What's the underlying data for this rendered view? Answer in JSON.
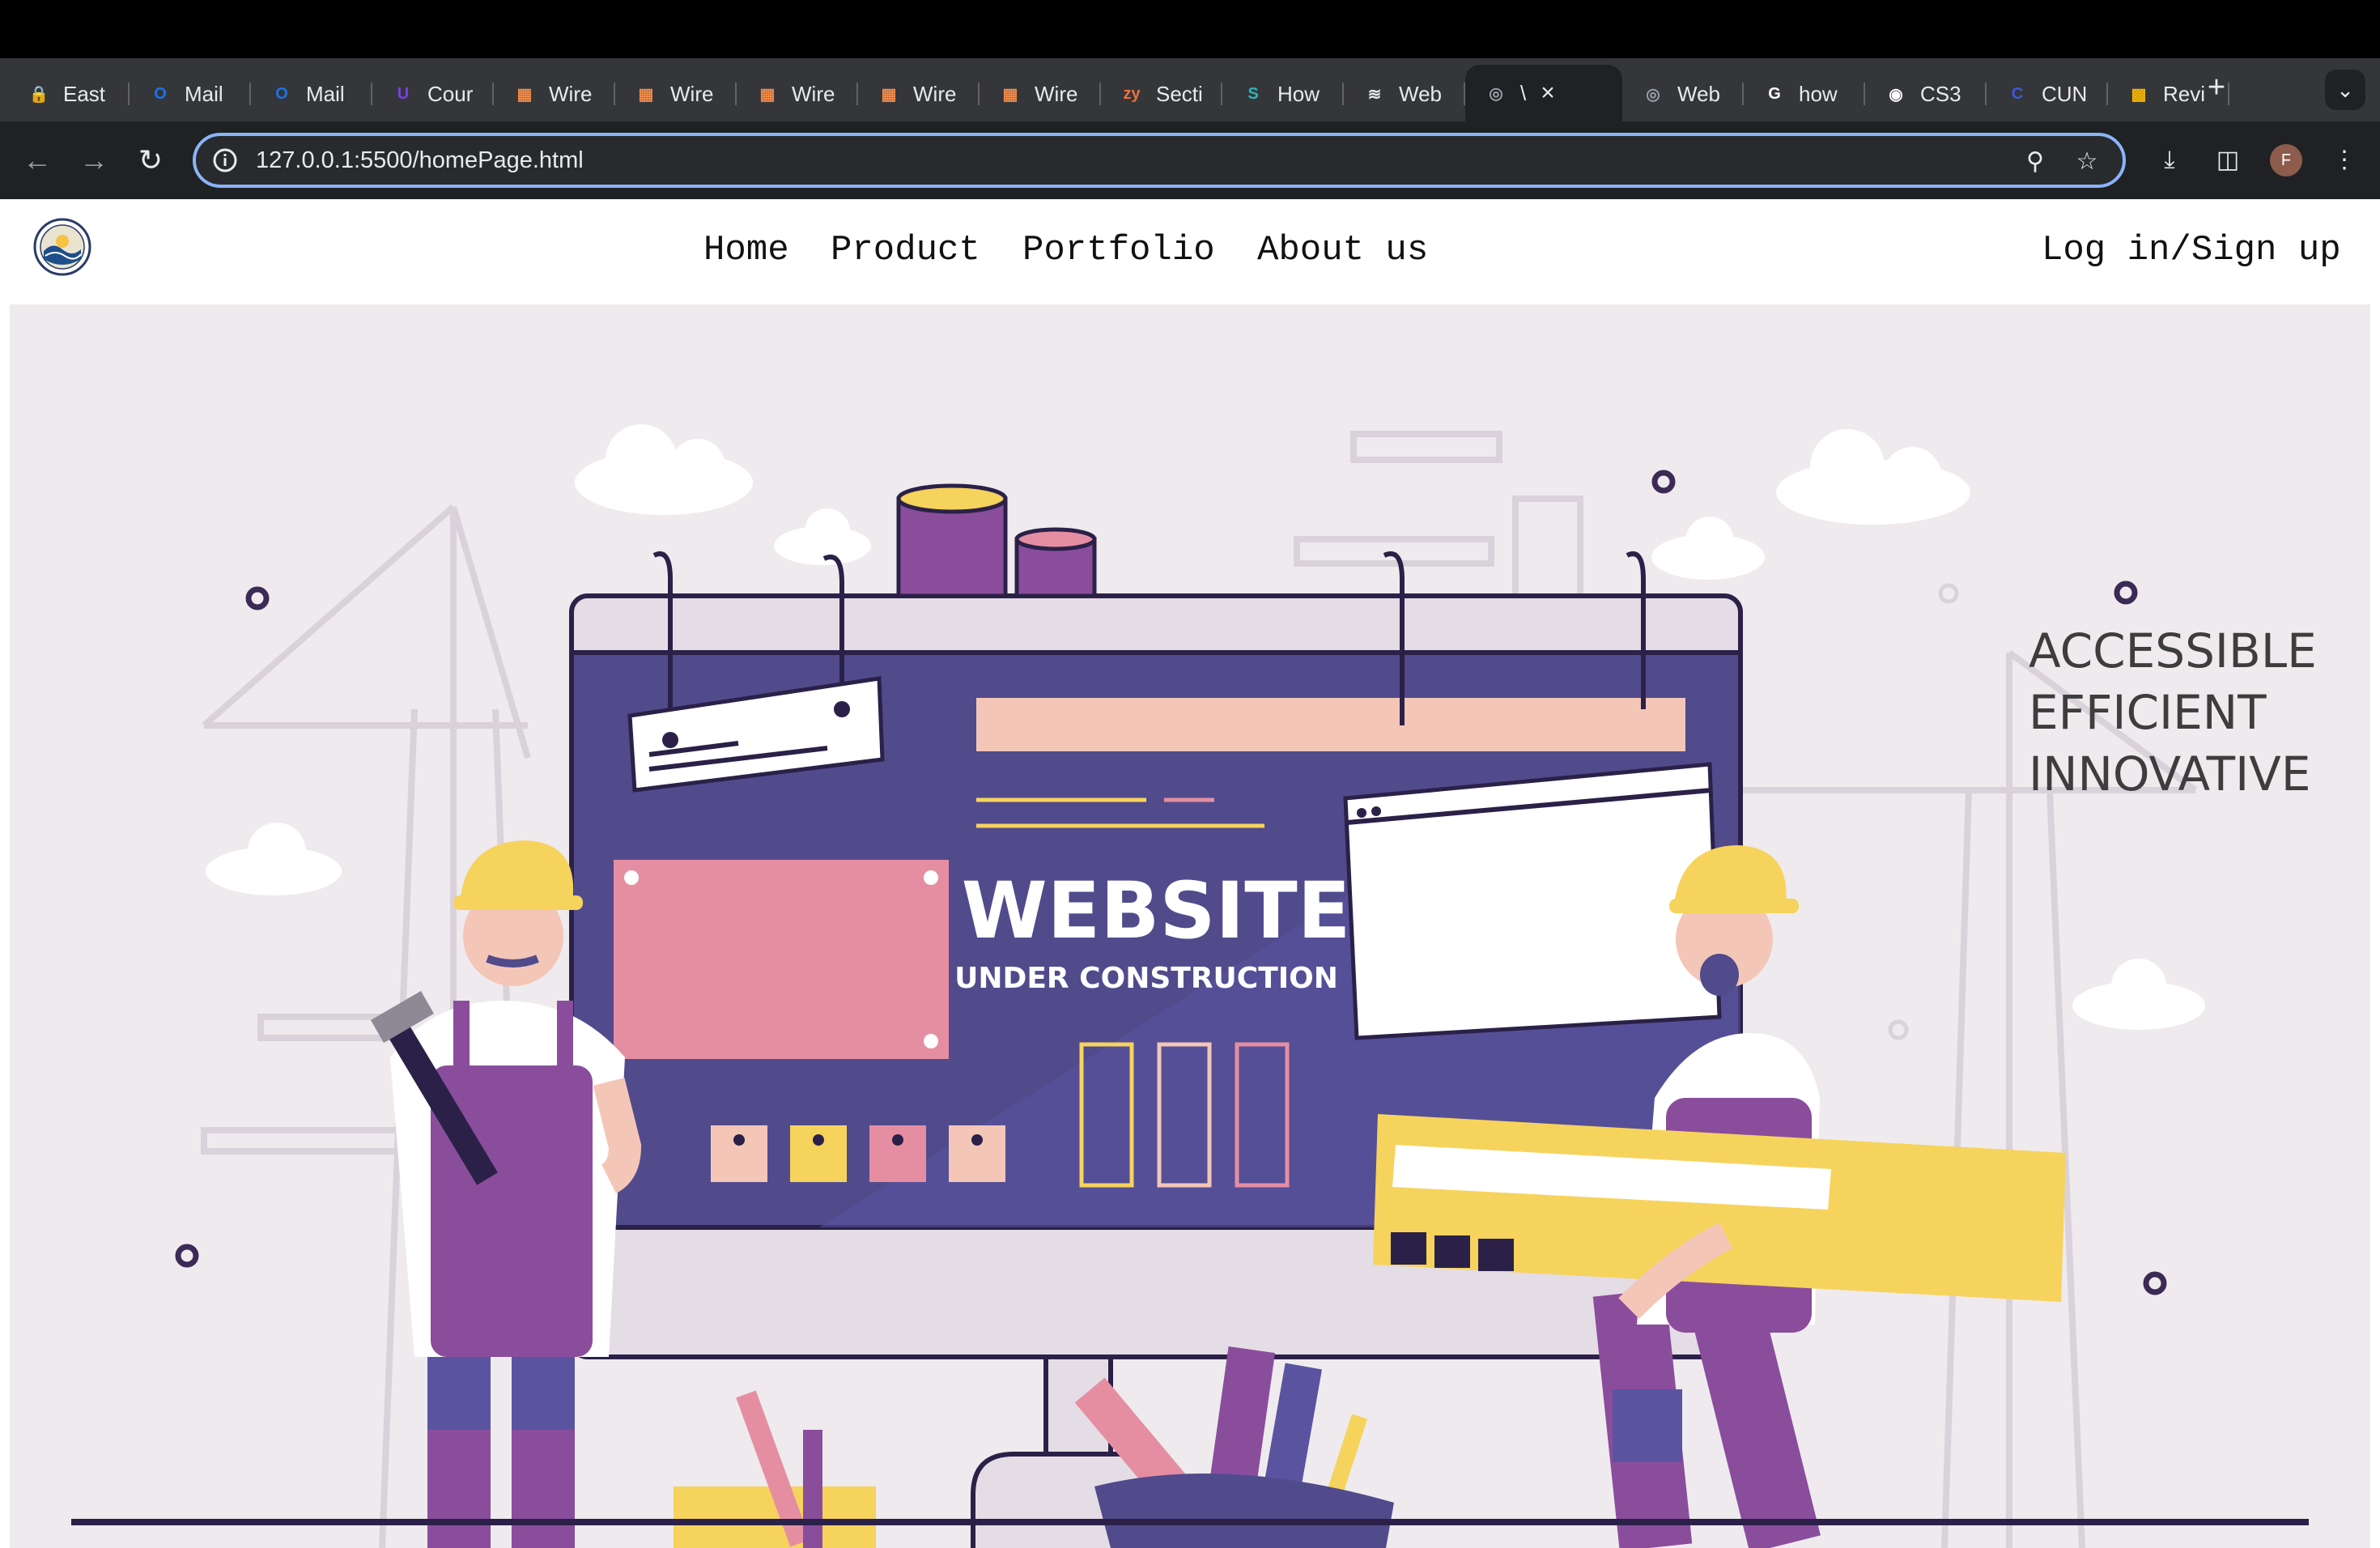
{
  "browser": {
    "tabs": [
      {
        "label": "East",
        "icon": "lock-icon",
        "color": "#4a7ff7"
      },
      {
        "label": "Mail",
        "icon": "outlook-icon",
        "color": "#1a73e8"
      },
      {
        "label": "Mail",
        "icon": "outlook-icon",
        "color": "#1a73e8"
      },
      {
        "label": "Cour",
        "icon": "course-icon",
        "color": "#7b3fe4"
      },
      {
        "label": "Wire",
        "icon": "wireframe-icon",
        "color": "#f08b4a"
      },
      {
        "label": "Wire",
        "icon": "wireframe-icon",
        "color": "#f08b4a"
      },
      {
        "label": "Wire",
        "icon": "wireframe-icon",
        "color": "#f08b4a"
      },
      {
        "label": "Wire",
        "icon": "wireframe-icon",
        "color": "#f08b4a"
      },
      {
        "label": "Wire",
        "icon": "wireframe-icon",
        "color": "#f08b4a"
      },
      {
        "label": "Secti",
        "icon": "zybooks-icon",
        "color": "#e8743b"
      },
      {
        "label": "How",
        "icon": "s-icon",
        "color": "#2bb5b8"
      },
      {
        "label": "Web",
        "icon": "squarespace-icon",
        "color": "#e8eaed"
      },
      {
        "label": "\\",
        "icon": "globe-icon",
        "color": "#9aa0a6",
        "active": true
      },
      {
        "label": "Web",
        "icon": "globe-icon",
        "color": "#9aa0a6"
      },
      {
        "label": "how",
        "icon": "google-icon",
        "color": "#ffffff"
      },
      {
        "label": "CS3",
        "icon": "github-icon",
        "color": "#ffffff"
      },
      {
        "label": "CUN",
        "icon": "cuny-icon",
        "color": "#3b5bdb"
      },
      {
        "label": "Revi",
        "icon": "chart-icon",
        "color": "#f4b400"
      }
    ],
    "new_tab_label": "+",
    "address": "127.0.0.1:5500/homePage.html",
    "profile_initial": "F"
  },
  "site": {
    "nav": {
      "home": "Home",
      "product": "Product",
      "portfolio": "Portfolio",
      "about": "About us",
      "login": "Log in/Sign up"
    },
    "tagline": [
      "ACCESSIBLE",
      "EFFICIENT",
      "INNOVATIVE"
    ],
    "hero": {
      "title": "WEBSITE",
      "subtitle": "UNDER CONSTRUCTION"
    }
  },
  "colors": {
    "hero_bg": "#efeaee",
    "screen": "#514b8c",
    "pink": "#e58ea2",
    "peach": "#f3c6b8",
    "yellow": "#f6d35c",
    "purple": "#8a4d9c",
    "dark": "#2b2148"
  }
}
